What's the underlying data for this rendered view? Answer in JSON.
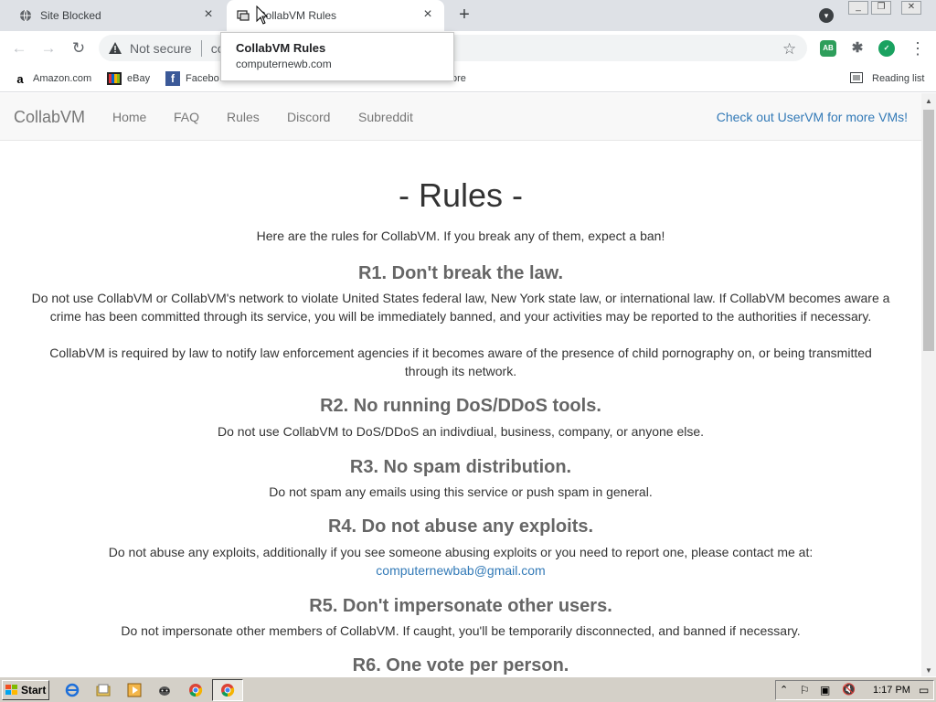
{
  "browser": {
    "tabs": [
      {
        "title": "Site Blocked",
        "favicon": "globe-icon"
      },
      {
        "title": "CollabVM Rules",
        "favicon": "collabvm-icon"
      }
    ],
    "new_tab_label": "+",
    "address": {
      "security_label": "Not secure",
      "url_partial": "co"
    },
    "hover_card": {
      "title": "CollabVM Rules",
      "url": "computernewb.com"
    },
    "bookmarks": [
      {
        "label": "Amazon.com",
        "icon": "amazon-icon"
      },
      {
        "label": "eBay",
        "icon": "ebay-icon"
      },
      {
        "label": "Facebo",
        "icon": "facebook-icon"
      },
      {
        "label": "ore",
        "icon": "folder-icon"
      }
    ],
    "reading_list_label": "Reading list",
    "extensions": [
      {
        "label": "AB",
        "color": "#2e9e5b"
      },
      {
        "label": "",
        "color": "#5f6368"
      },
      {
        "label": "",
        "color": "#1aa260"
      }
    ]
  },
  "site": {
    "brand": "CollabVM",
    "nav": [
      "Home",
      "FAQ",
      "Rules",
      "Discord",
      "Subreddit"
    ],
    "nav_right": "Check out UserVM for more VMs!",
    "heading": "- Rules -",
    "intro": "Here are the rules for CollabVM. If you break any of them, expect a ban!",
    "rules": [
      {
        "title": "R1. Don't break the law.",
        "p1": "Do not use CollabVM or CollabVM's network to violate United States federal law, New York state law, or international law. If CollabVM becomes aware a crime has been committed through its service, you will be immediately banned, and your activities may be reported to the authorities if necessary.",
        "p2": "CollabVM is required by law to notify law enforcement agencies if it becomes aware of the presence of child pornography on, or being transmitted through its network."
      },
      {
        "title": "R2. No running DoS/DDoS tools.",
        "p1": "Do not use CollabVM to DoS/DDoS an indivdiual, business, company, or anyone else."
      },
      {
        "title": "R3. No spam distribution.",
        "p1": "Do not spam any emails using this service or push spam in general."
      },
      {
        "title": "R4. Do not abuse any exploits.",
        "p1": "Do not abuse any exploits, additionally if you see someone abusing exploits or you need to report one, please contact me at:",
        "email": "computernewbab@gmail.com"
      },
      {
        "title": "R5. Don't impersonate other users.",
        "p1": "Do not impersonate other members of CollabVM. If caught, you'll be temporarily disconnected, and banned if necessary."
      },
      {
        "title": "R6. One vote per person."
      }
    ]
  },
  "taskbar": {
    "start_label": "Start",
    "clock": "1:17 PM"
  },
  "colors": {
    "link": "#337ab7",
    "tabstrip": "#dee1e6",
    "taskbar": "#d4d0c8"
  }
}
